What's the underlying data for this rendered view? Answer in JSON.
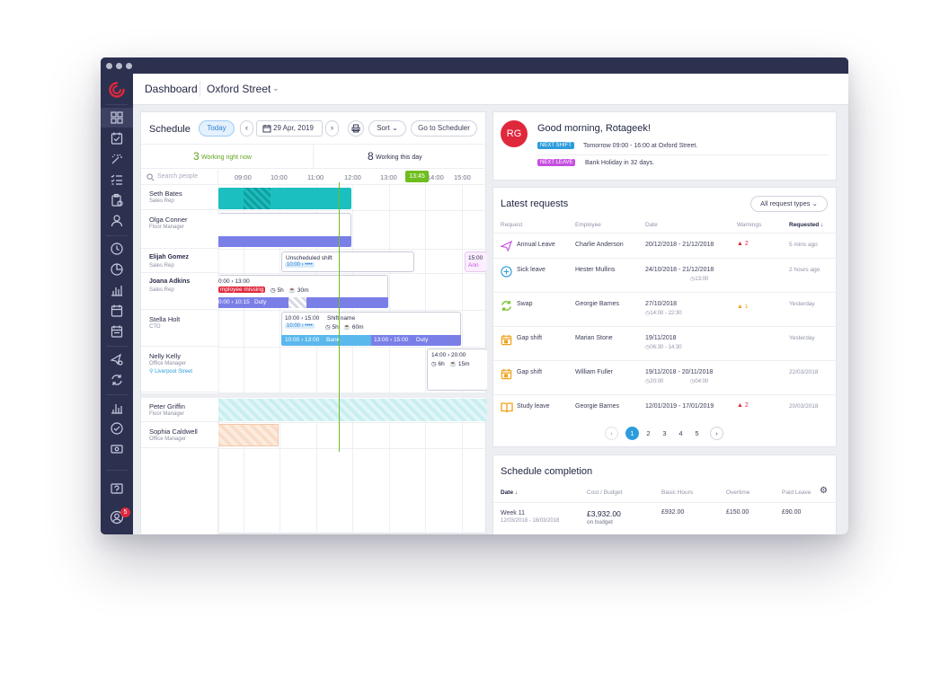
{
  "colors": {
    "sidebar": "#2d3150",
    "accent": "#2d9cdb",
    "teal": "#1bbfbf",
    "purple": "#7a7fe8",
    "green": "#7cc321",
    "red": "#e0283c",
    "pink": "#c64fe0"
  },
  "topbar": {
    "title": "Dashboard",
    "location": "Oxford Street"
  },
  "sidebar": {
    "icons": [
      "dashboard-icon",
      "checklist-icon",
      "magic-icon",
      "task-list-icon",
      "clipboard-icon",
      "person-icon",
      "clock-icon",
      "pie-chart-icon",
      "bar-chart-icon",
      "calendar-icon",
      "calendar-alt-icon",
      "plane-settings-icon",
      "sync-settings-icon",
      "analytics-icon",
      "check-circle-icon",
      "cash-icon",
      "help-icon",
      "user-icon"
    ],
    "notification_count": "5"
  },
  "schedule": {
    "title": "Schedule",
    "today_label": "Today",
    "date": "29 Apr, 2019",
    "sort_label": "Sort",
    "goto_label": "Go to Scheduler",
    "working_now_count": "3",
    "working_now_label": "Working right now",
    "working_day_count": "8",
    "working_day_label": "Working this day",
    "search_placeholder": "Search people",
    "hours": [
      "09:00",
      "10:00",
      "11:00",
      "12:00",
      "13:00",
      "14:00",
      "15:00"
    ],
    "now_marker": "13:45",
    "people": [
      {
        "name": "Seth Bates",
        "role": "Sales Rep"
      },
      {
        "name": "Olga Conner",
        "role": "Floor Manager"
      },
      {
        "name": "Elijah Gomez",
        "role": "Sales Rep"
      },
      {
        "name": "Joana Adkins",
        "role": "Sales Rep"
      },
      {
        "name": "Stella Holt",
        "role": "CTO"
      },
      {
        "name": "Nelly Kelly",
        "role": "Office Manager",
        "location": "Liverpool Street"
      },
      {
        "name": "Peter Griffin",
        "role": "Floor Manager"
      },
      {
        "name": "Sophia Caldwell",
        "role": "Office Manager"
      }
    ],
    "shifts": {
      "elijah_title": "Unscheduled shift",
      "elijah_time": "10:00 › ••••",
      "elijah_overflow_time": "15:00",
      "elijah_overflow_sub": "Ann",
      "joana_time": "0:00 › 13:00",
      "joana_warning": "mployee missing",
      "joana_hours": "5h",
      "joana_break": "30m",
      "joana_duty_time": "0:00 › 10:15",
      "joana_duty_label": "Duty",
      "stella_time": "10:00 › 15:00",
      "stella_title": "Shift name",
      "stella_sub_time": "10:00 › ••••",
      "stella_hours": "5h",
      "stella_break": "60m",
      "stella_bank_time": "10:00 › 13:00",
      "stella_bank_label": "Bank",
      "stella_duty_time": "13:00 › 15:00",
      "stella_duty_label": "Duty",
      "nelly_time": "14:00 › 20:00",
      "nelly_hours": "6h",
      "nelly_break": "15m"
    }
  },
  "greeting": {
    "initials": "RG",
    "text": "Good morning, Rotageek!",
    "next_shift_label": "NEXT SHIFT",
    "next_shift_text": "Tomorrow  09:00 - 16:00 at Oxford Street.",
    "next_leave_label": "NEXT LEAVE",
    "next_leave_text": "Bank Holiday in 32 days."
  },
  "requests": {
    "title": "Latest requests",
    "filter": "All request types",
    "headers": {
      "request": "Request",
      "employee": "Employee",
      "date": "Date",
      "warnings": "Warnings",
      "requested": "Requested"
    },
    "rows": [
      {
        "type": "Annual Leave",
        "icon": "plane-icon",
        "employee": "Charlie Anderson",
        "date": "20/12/2018 - 21/12/2018",
        "sub": "",
        "warning": "2",
        "warn_level": "red",
        "requested": "5 mins ago"
      },
      {
        "type": "Sick leave",
        "icon": "medical-icon",
        "employee": "Hester Mullins",
        "date": "24/10/2018 - 21/12/2018",
        "sub": "13:00",
        "warning": "",
        "warn_level": "",
        "requested": "2 hours ago"
      },
      {
        "type": "Swap",
        "icon": "swap-icon",
        "employee": "Georgie Barnes",
        "date": "27/10/2018",
        "sub": "14:00 - 22:30",
        "warning": "1",
        "warn_level": "orange",
        "requested": "Yesterday"
      },
      {
        "type": "Gap shift",
        "icon": "gap-shift-icon",
        "employee": "Marian Stone",
        "date": "19/11/2018",
        "sub": "06:30 - 14:30",
        "warning": "",
        "warn_level": "",
        "requested": "Yesterday"
      },
      {
        "type": "Gap shift",
        "icon": "gap-shift-icon",
        "employee": "William Fuller",
        "date": "19/11/2018 - 20/11/2018",
        "sub": "20:00",
        "sub2": "04:00",
        "warning": "",
        "warn_level": "",
        "requested": "22/03/2018"
      },
      {
        "type": "Study leave",
        "icon": "book-icon",
        "employee": "Georgie Barnes",
        "date": "12/01/2019 - 17/01/2019",
        "sub": "",
        "warning": "2",
        "warn_level": "red",
        "requested": "20/03/2018"
      }
    ],
    "pages": [
      "1",
      "2",
      "3",
      "4",
      "5"
    ]
  },
  "completion": {
    "title": "Schedule completion",
    "headers": {
      "date": "Date",
      "cost": "Cost / Budget",
      "basic": "Basic Hours",
      "overtime": "Overtime",
      "paid": "Paid Leave"
    },
    "row": {
      "week": "Week 11",
      "range": "12/03/2018 - 18/03/2018",
      "cost": "£3,932.00",
      "cost_sub": "on budget",
      "basic": "£932.00",
      "overtime": "£150.00",
      "paid": "£90.00"
    }
  }
}
